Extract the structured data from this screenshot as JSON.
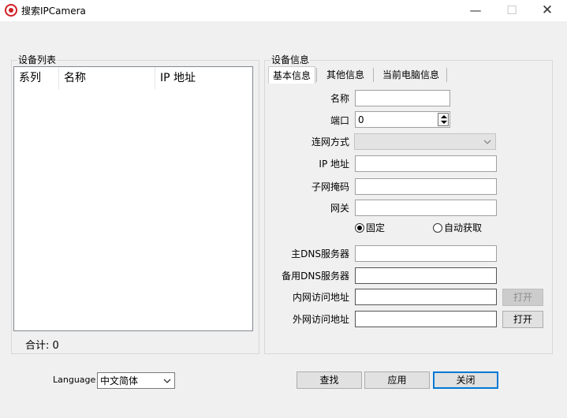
{
  "window": {
    "title": "搜索IPCamera",
    "minimize_glyph": "—",
    "maximize_glyph": "☐",
    "close_glyph": "✕"
  },
  "device_list": {
    "group_label": "设备列表",
    "columns": [
      "系列",
      "名称",
      "IP 地址"
    ],
    "total_label": "合计: 0"
  },
  "device_info": {
    "group_label": "设备信息",
    "tabs": [
      "基本信息",
      "其他信息",
      "当前电脑信息"
    ],
    "fields": {
      "name_label": "名称",
      "name_value": "",
      "port_label": "端口",
      "port_value": "0",
      "conn_label": "连网方式",
      "conn_value": "",
      "ip_label": "IP 地址",
      "ip_value": "",
      "mask_label": "子网掩码",
      "mask_value": "",
      "gateway_label": "网关",
      "gateway_value": "",
      "dns1_label": "主DNS服务器",
      "dns1_value": "",
      "dns2_label": "备用DNS服务器",
      "dns2_value": "",
      "lan_label": "内网访问地址",
      "lan_value": "",
      "wan_label": "外网访问地址",
      "wan_value": ""
    },
    "radio_fixed": "固定",
    "radio_auto": "自动获取",
    "open_lan_label": "打开",
    "open_wan_label": "打开"
  },
  "footer": {
    "language_label": "Language",
    "language_value": "中文简体",
    "search_label": "查找",
    "apply_label": "应用",
    "close_label": "关闭"
  }
}
